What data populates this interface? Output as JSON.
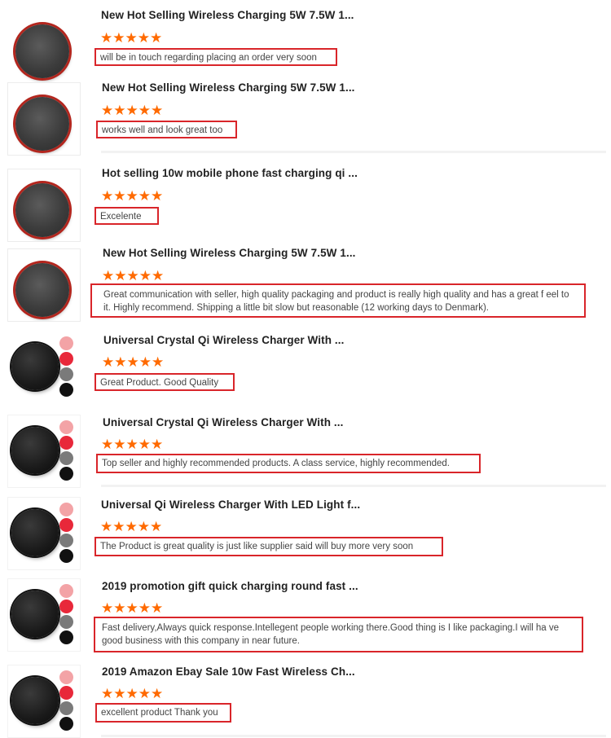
{
  "colors": {
    "star": "#ff6a00",
    "highlight_border": "#d9252a",
    "pad_red_rim": "#b3261e"
  },
  "reviews": [
    {
      "product_title": "New Hot Selling Wireless Charging 5W 7.5W 1...",
      "stars": "★★★★★",
      "rating": 5,
      "comment": "will be in touch regarding placing an order very soon",
      "thumb_icon": "charging-pad-red-rim-icon"
    },
    {
      "product_title": "New Hot Selling Wireless Charging 5W 7.5W 1...",
      "stars": "★★★★★",
      "rating": 5,
      "comment": "works well and look great too",
      "thumb_icon": "charging-pad-red-rim-icon"
    },
    {
      "product_title": "Hot selling 10w mobile phone fast charging qi ...",
      "stars": "★★★★★",
      "rating": 5,
      "comment": "Excelente",
      "thumb_icon": "charging-pad-red-rim-icon"
    },
    {
      "product_title": "New Hot Selling Wireless Charging 5W 7.5W 1...",
      "stars": "★★★★★",
      "rating": 5,
      "comment": "Great communication with seller, high quality packaging and product is really high quality and has a great f eel to it. Highly recommend. Shipping a little bit slow but reasonable (12 working days to Denmark).",
      "thumb_icon": "charging-pad-red-rim-icon"
    },
    {
      "product_title": "Universal Crystal Qi Wireless Charger With ...",
      "stars": "★★★★★",
      "rating": 5,
      "comment": "Great Product. Good Quality",
      "thumb_icon": "charging-pad-black-color-options-icon"
    },
    {
      "product_title": "Universal Crystal Qi Wireless Charger With ...",
      "stars": "★★★★★",
      "rating": 5,
      "comment": "Top seller and highly recommended products. A class service, highly recommended.",
      "thumb_icon": "charging-pad-black-color-options-icon"
    },
    {
      "product_title": "Universal Qi Wireless Charger With LED Light f...",
      "stars": "★★★★★",
      "rating": 5,
      "comment": "The Product is great quality is just like supplier said will buy more very soon",
      "thumb_icon": "charging-pad-black-color-options-icon"
    },
    {
      "product_title": "2019 promotion gift quick charging round fast ...",
      "stars": "★★★★★",
      "rating": 5,
      "comment": "Fast delivery,Always quick response.Intellegent people working there.Good thing is I like packaging.I will ha ve good business with this company in near future.",
      "thumb_icon": "charging-pad-black-color-options-icon"
    },
    {
      "product_title": "2019 Amazon Ebay Sale 10w Fast Wireless Ch...",
      "stars": "★★★★★",
      "rating": 5,
      "comment": "excellent product Thank you",
      "thumb_icon": "charging-pad-black-color-options-icon"
    }
  ]
}
